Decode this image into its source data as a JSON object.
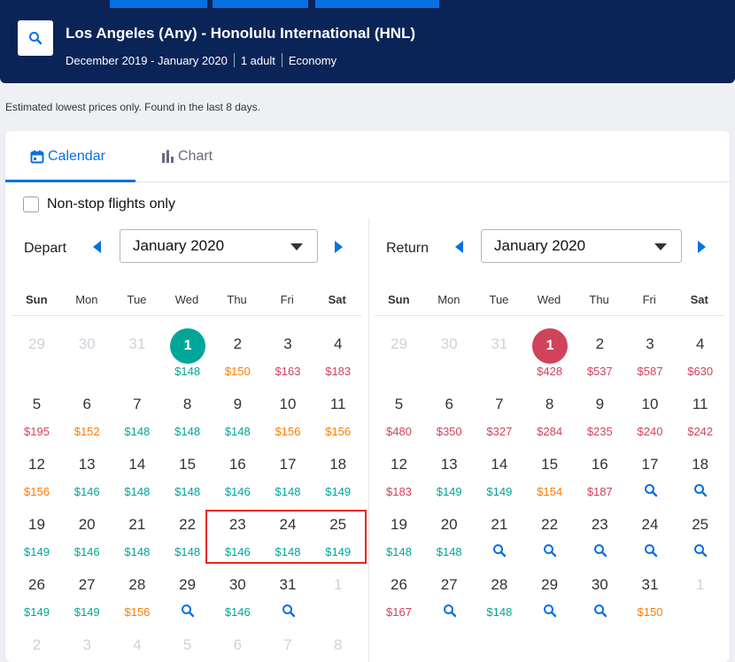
{
  "header": {
    "route": "Los Angeles (Any) - Honolulu International (HNL)",
    "dates": "December 2019 - January 2020",
    "travellers": "1 adult",
    "cabin": "Economy"
  },
  "note": "Estimated lowest prices only. Found in the last 8 days.",
  "tabs": [
    {
      "label": "Calendar",
      "icon": "calendar-icon"
    },
    {
      "label": "Chart",
      "icon": "bar-chart-icon"
    }
  ],
  "nonstop_label": "Non-stop flights only",
  "colors": {
    "navy": "#0b2457",
    "blue": "#0770e3",
    "green": "#00a698",
    "orange": "#ff7b00",
    "red": "#d1435b",
    "highlight": "#e8261d"
  },
  "weekdays": [
    "Sun",
    "Mon",
    "Tue",
    "Wed",
    "Thu",
    "Fri",
    "Sat"
  ],
  "depart": {
    "label": "Depart",
    "month": "January 2020",
    "selected_day": "1",
    "weeks": [
      [
        {
          "d": "29",
          "m": true
        },
        {
          "d": "30",
          "m": true
        },
        {
          "d": "31",
          "m": true
        },
        {
          "d": "1",
          "p": "$148",
          "c": "green",
          "sel": true
        },
        {
          "d": "2",
          "p": "$150",
          "c": "orange"
        },
        {
          "d": "3",
          "p": "$163",
          "c": "red"
        },
        {
          "d": "4",
          "p": "$183",
          "c": "red"
        }
      ],
      [
        {
          "d": "5",
          "p": "$195",
          "c": "red"
        },
        {
          "d": "6",
          "p": "$152",
          "c": "orange"
        },
        {
          "d": "7",
          "p": "$148",
          "c": "green"
        },
        {
          "d": "8",
          "p": "$148",
          "c": "green"
        },
        {
          "d": "9",
          "p": "$148",
          "c": "green"
        },
        {
          "d": "10",
          "p": "$156",
          "c": "orange"
        },
        {
          "d": "11",
          "p": "$156",
          "c": "orange"
        }
      ],
      [
        {
          "d": "12",
          "p": "$156",
          "c": "orange"
        },
        {
          "d": "13",
          "p": "$146",
          "c": "green"
        },
        {
          "d": "14",
          "p": "$148",
          "c": "green"
        },
        {
          "d": "15",
          "p": "$148",
          "c": "green"
        },
        {
          "d": "16",
          "p": "$146",
          "c": "green"
        },
        {
          "d": "17",
          "p": "$148",
          "c": "green"
        },
        {
          "d": "18",
          "p": "$149",
          "c": "green"
        }
      ],
      [
        {
          "d": "19",
          "p": "$149",
          "c": "green"
        },
        {
          "d": "20",
          "p": "$146",
          "c": "green"
        },
        {
          "d": "21",
          "p": "$148",
          "c": "green"
        },
        {
          "d": "22",
          "p": "$148",
          "c": "green"
        },
        {
          "d": "23",
          "p": "$146",
          "c": "green"
        },
        {
          "d": "24",
          "p": "$148",
          "c": "green"
        },
        {
          "d": "25",
          "p": "$149",
          "c": "green"
        }
      ],
      [
        {
          "d": "26",
          "p": "$149",
          "c": "green"
        },
        {
          "d": "27",
          "p": "$149",
          "c": "green"
        },
        {
          "d": "28",
          "p": "$156",
          "c": "orange"
        },
        {
          "d": "29",
          "s": true
        },
        {
          "d": "30",
          "p": "$146",
          "c": "green"
        },
        {
          "d": "31",
          "s": true
        },
        {
          "d": "1",
          "m": true
        }
      ],
      [
        {
          "d": "2",
          "m": true
        },
        {
          "d": "3",
          "m": true
        },
        {
          "d": "4",
          "m": true
        },
        {
          "d": "5",
          "m": true
        },
        {
          "d": "6",
          "m": true
        },
        {
          "d": "7",
          "m": true
        },
        {
          "d": "8",
          "m": true
        }
      ]
    ]
  },
  "return": {
    "label": "Return",
    "month": "January 2020",
    "selected_day": "1",
    "weeks": [
      [
        {
          "d": "29",
          "m": true
        },
        {
          "d": "30",
          "m": true
        },
        {
          "d": "31",
          "m": true
        },
        {
          "d": "1",
          "p": "$428",
          "c": "red",
          "sel": true
        },
        {
          "d": "2",
          "p": "$537",
          "c": "red"
        },
        {
          "d": "3",
          "p": "$587",
          "c": "red"
        },
        {
          "d": "4",
          "p": "$630",
          "c": "red"
        }
      ],
      [
        {
          "d": "5",
          "p": "$480",
          "c": "red"
        },
        {
          "d": "6",
          "p": "$350",
          "c": "red"
        },
        {
          "d": "7",
          "p": "$327",
          "c": "red"
        },
        {
          "d": "8",
          "p": "$284",
          "c": "red"
        },
        {
          "d": "9",
          "p": "$235",
          "c": "red"
        },
        {
          "d": "10",
          "p": "$240",
          "c": "red"
        },
        {
          "d": "11",
          "p": "$242",
          "c": "red"
        }
      ],
      [
        {
          "d": "12",
          "p": "$183",
          "c": "red"
        },
        {
          "d": "13",
          "p": "$149",
          "c": "green"
        },
        {
          "d": "14",
          "p": "$149",
          "c": "green"
        },
        {
          "d": "15",
          "p": "$154",
          "c": "orange"
        },
        {
          "d": "16",
          "p": "$187",
          "c": "red"
        },
        {
          "d": "17",
          "s": true
        },
        {
          "d": "18",
          "s": true
        }
      ],
      [
        {
          "d": "19",
          "p": "$148",
          "c": "green"
        },
        {
          "d": "20",
          "p": "$148",
          "c": "green"
        },
        {
          "d": "21",
          "s": true
        },
        {
          "d": "22",
          "s": true
        },
        {
          "d": "23",
          "s": true
        },
        {
          "d": "24",
          "s": true
        },
        {
          "d": "25",
          "s": true
        }
      ],
      [
        {
          "d": "26",
          "p": "$167",
          "c": "red"
        },
        {
          "d": "27",
          "s": true
        },
        {
          "d": "28",
          "p": "$148",
          "c": "green"
        },
        {
          "d": "29",
          "s": true
        },
        {
          "d": "30",
          "s": true
        },
        {
          "d": "31",
          "p": "$150",
          "c": "orange"
        },
        {
          "d": "1",
          "m": true
        }
      ]
    ]
  }
}
